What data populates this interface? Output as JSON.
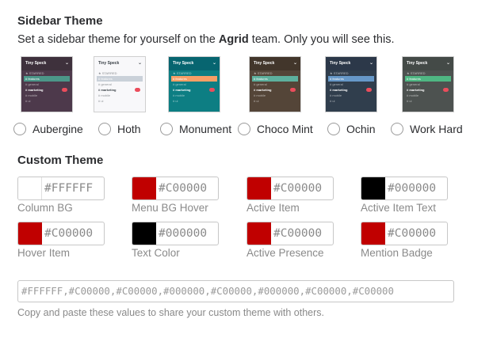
{
  "sidebar_theme": {
    "title": "Sidebar Theme",
    "subtitle_prefix": "Set a sidebar theme for yourself on the ",
    "team_name": "Agrid",
    "subtitle_suffix": " team. Only you will see this.",
    "themes": [
      {
        "name": "Aubergine",
        "bg": "#4d394b",
        "header_bg": "#3e313c",
        "text": "#ffffff",
        "active": "#4c9689",
        "workspace": "Tiny Speck"
      },
      {
        "name": "Hoth",
        "bg": "#f8f8fa",
        "header_bg": "#f8f8fa",
        "text": "#383f45",
        "active": "#cad1d9",
        "workspace": "Tiny Speck"
      },
      {
        "name": "Monument",
        "bg": "#0d7e83",
        "header_bg": "#076570",
        "text": "#ffffff",
        "active": "#f79f66",
        "workspace": "Tiny Speck"
      },
      {
        "name": "Choco Mint",
        "bg": "#544538",
        "header_bg": "#42362b",
        "text": "#ffffff",
        "active": "#5db09d",
        "workspace": "Tiny Speck"
      },
      {
        "name": "Ochin",
        "bg": "#303e4d",
        "header_bg": "#2c3849",
        "text": "#ffffff",
        "active": "#6698c8",
        "workspace": "Tiny Speck"
      },
      {
        "name": "Work Hard",
        "bg": "#4d5250",
        "header_bg": "#444a47",
        "text": "#ffffff",
        "active": "#4fb783",
        "workspace": "Tiny Speck"
      }
    ],
    "preview_rows": [
      "★ STARRED",
      "# features",
      "# general",
      "# marketing",
      "# mobile",
      "# ui"
    ]
  },
  "custom_theme": {
    "title": "Custom Theme",
    "colors": [
      {
        "label": "Column BG",
        "value": "#FFFFFF",
        "swatch": "#FFFFFF"
      },
      {
        "label": "Menu BG Hover",
        "value": "#C00000",
        "swatch": "#C00000"
      },
      {
        "label": "Active Item",
        "value": "#C00000",
        "swatch": "#C00000"
      },
      {
        "label": "Active Item Text",
        "value": "#000000",
        "swatch": "#000000"
      },
      {
        "label": "Hover Item",
        "value": "#C00000",
        "swatch": "#C00000"
      },
      {
        "label": "Text Color",
        "value": "#000000",
        "swatch": "#000000"
      },
      {
        "label": "Active Presence",
        "value": "#C00000",
        "swatch": "#C00000"
      },
      {
        "label": "Mention Badge",
        "value": "#C00000",
        "swatch": "#C00000"
      }
    ],
    "theme_string": "#FFFFFF,#C00000,#C00000,#000000,#C00000,#000000,#C00000,#C00000",
    "hint": "Copy and paste these values to share your custom theme with others."
  }
}
